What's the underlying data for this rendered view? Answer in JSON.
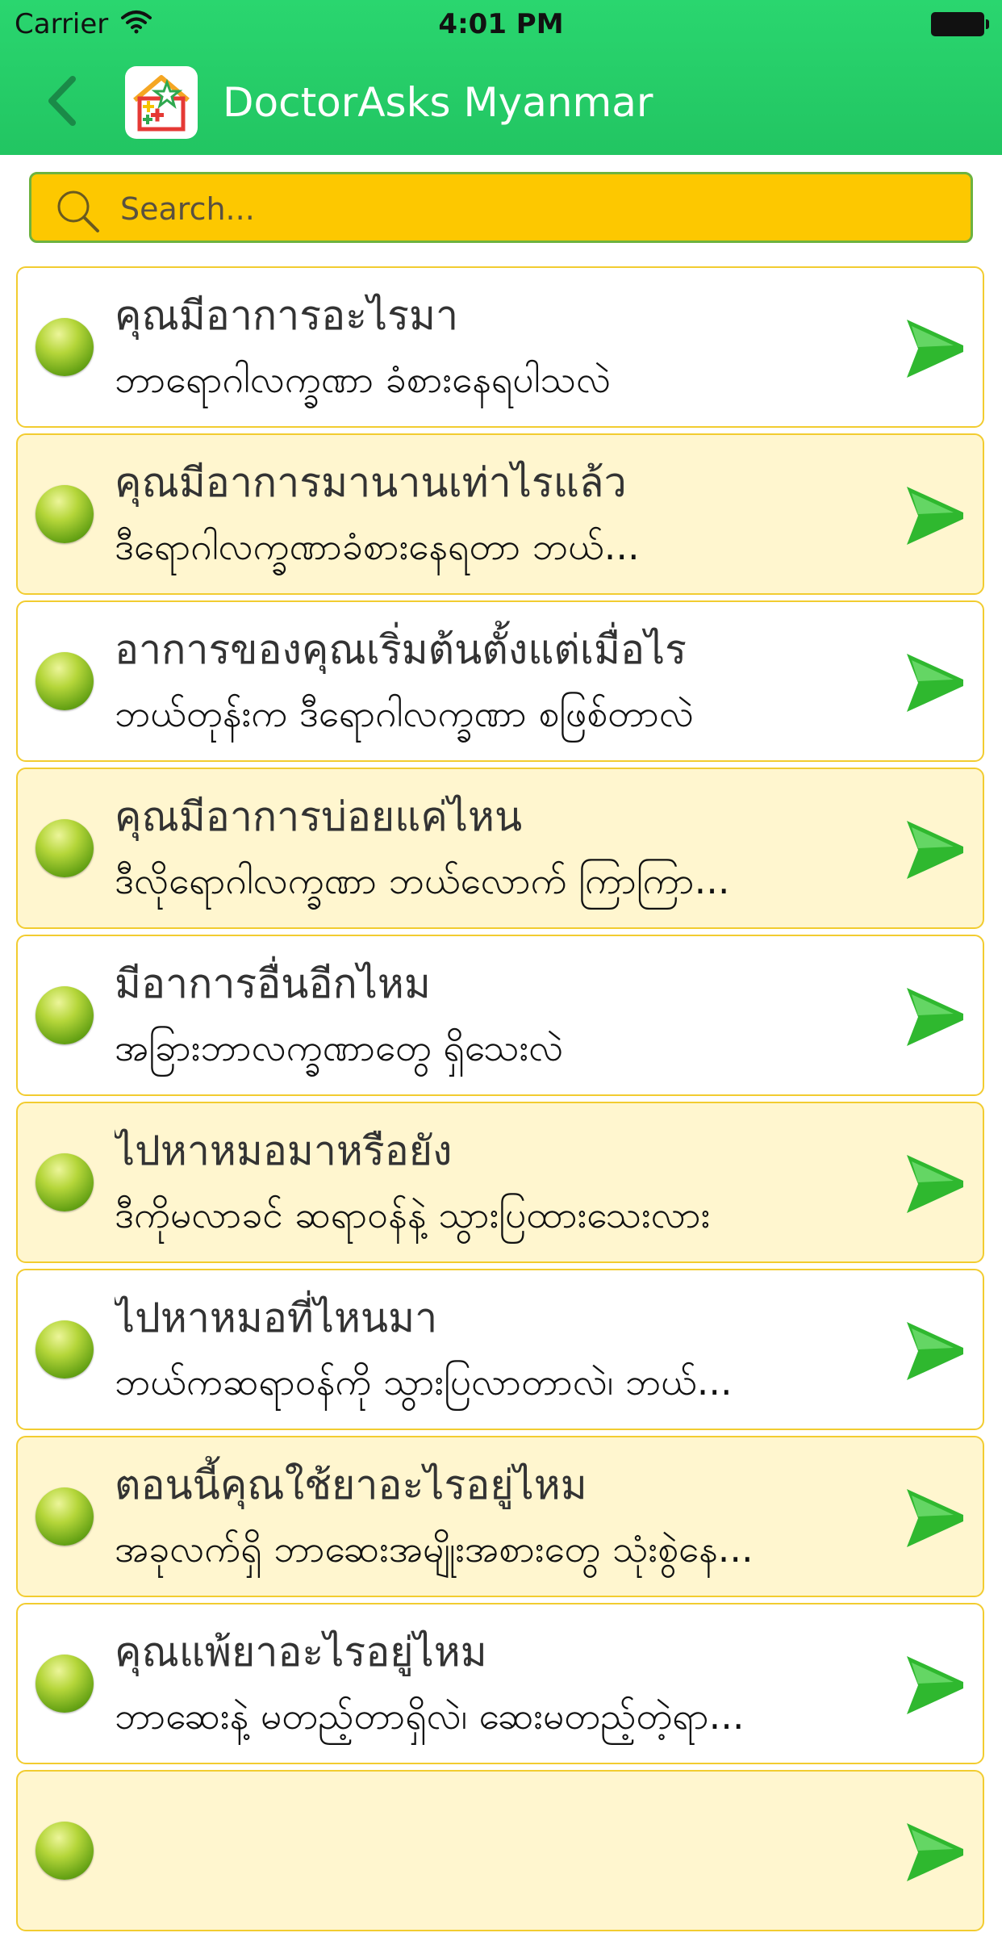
{
  "status_bar": {
    "carrier": "Carrier",
    "time": "4:01 PM"
  },
  "nav": {
    "title": "DoctorAsks Myanmar"
  },
  "search": {
    "placeholder": "Search..."
  },
  "items": [
    {
      "title": "คุณมีอาการอะไรมา",
      "subtitle": "ဘာရောဂါလက္ခဏာ ခံစားနေရပါသလဲ"
    },
    {
      "title": "คุณมีอาการมานานเท่าไรแล้ว",
      "subtitle": "ဒီရောဂါလက္ခဏာခံစားနေရတာ     ဘယ်..."
    },
    {
      "title": "อาการของคุณเริ่มต้นตั้งแต่เมื่อไร",
      "subtitle": "ဘယ်တုန်းက ဒီရောဂါလက္ခဏာ စဖြစ်တာလဲ"
    },
    {
      "title": "คุณมีอาการบ่อยแค่ไหน",
      "subtitle": "ဒီလိုရောဂါလက္ခဏာ ဘယ်လောက် ကြာကြာ..."
    },
    {
      "title": "มีอาการอื่นอีกไหม",
      "subtitle": "အခြားဘာလက္ခဏာတွေ ရှိသေးလဲ"
    },
    {
      "title": "ไปหาหมอมาหรือยัง",
      "subtitle": "ဒီကိုမလာခင် ဆရာဝန်နဲ့ သွားပြထားသေးလား"
    },
    {
      "title": "ไปหาหมอที่ไหนมา",
      "subtitle": "ဘယ်ကဆရာဝန်ကို သွားပြလာတာလဲ၊ ဘယ်..."
    },
    {
      "title": "ตอนนี้คุณใช้ยาอะไรอยู่ไหม",
      "subtitle": "အခုလက်ရှိ ဘာဆေးအမျိုးအစားတွေ သုံးစွဲနေ..."
    },
    {
      "title": "คุณแพ้ยาอะไรอยู่ไหม",
      "subtitle": "ဘာဆေးနဲ့ မတည့်တာရှိလဲ၊ ဆေးမတည့်တဲ့ရာ..."
    },
    {
      "title": "",
      "subtitle": ""
    }
  ],
  "colors": {
    "nav_bar": "#22c562",
    "search_bg": "#fdc800",
    "row_alt": "#fff6cf",
    "row_border": "#f2cc30",
    "chevron": "#2fb82f"
  },
  "icons": {
    "back": "chevron-left-icon",
    "app": "house-star-icon",
    "search": "search-icon",
    "row_bullet": "green-dot-icon",
    "row_arrow": "chevron-right-icon"
  }
}
